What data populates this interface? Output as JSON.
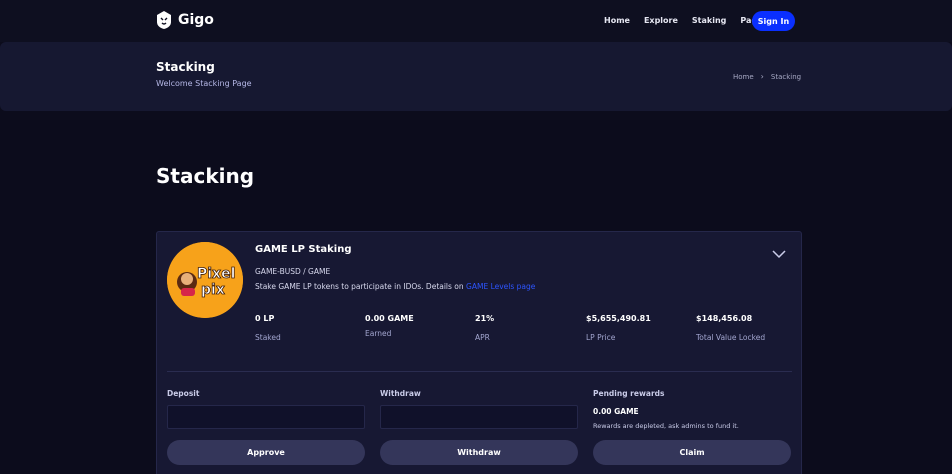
{
  "brand": {
    "name": "Gigo"
  },
  "nav": {
    "items": [
      "Home",
      "Explore",
      "Staking",
      "Pages"
    ],
    "signin": "Sign In"
  },
  "banner": {
    "title": "Stacking",
    "subtitle": "Welcome Stacking Page",
    "breadcrumb": [
      "Home",
      "Stacking"
    ]
  },
  "page": {
    "heading": "Stacking"
  },
  "pool": {
    "logo_text": [
      "Pixel",
      "pix"
    ],
    "title": "GAME LP Staking",
    "pair": "GAME-BUSD / GAME",
    "description": "Stake GAME LP tokens to participate in IDOs. Details on",
    "link": "GAME Levels page",
    "stats": [
      {
        "value": "0 LP",
        "label": "Staked"
      },
      {
        "value": "0.00 GAME",
        "label": "Earned"
      },
      {
        "value": "21%",
        "label": "APR"
      },
      {
        "value": "$5,655,490.81",
        "label": "LP Price"
      },
      {
        "value": "$148,456.08",
        "label": "Total Value Locked"
      }
    ]
  },
  "actions": {
    "deposit": {
      "label": "Deposit",
      "value": "",
      "button": "Approve"
    },
    "withdraw": {
      "label": "Withdraw",
      "value": "",
      "button": "Withdraw"
    },
    "pending": {
      "label": "Pending rewards",
      "value": "0.00 GAME",
      "note": "Rewards are depleted, ask admins to fund it.",
      "button": "Claim"
    }
  },
  "colors": {
    "accent": "#0a2fff",
    "link": "#2d55ff",
    "background": "#0c0c1c",
    "card": "#171833",
    "logo_bg": "#f7a21a"
  }
}
